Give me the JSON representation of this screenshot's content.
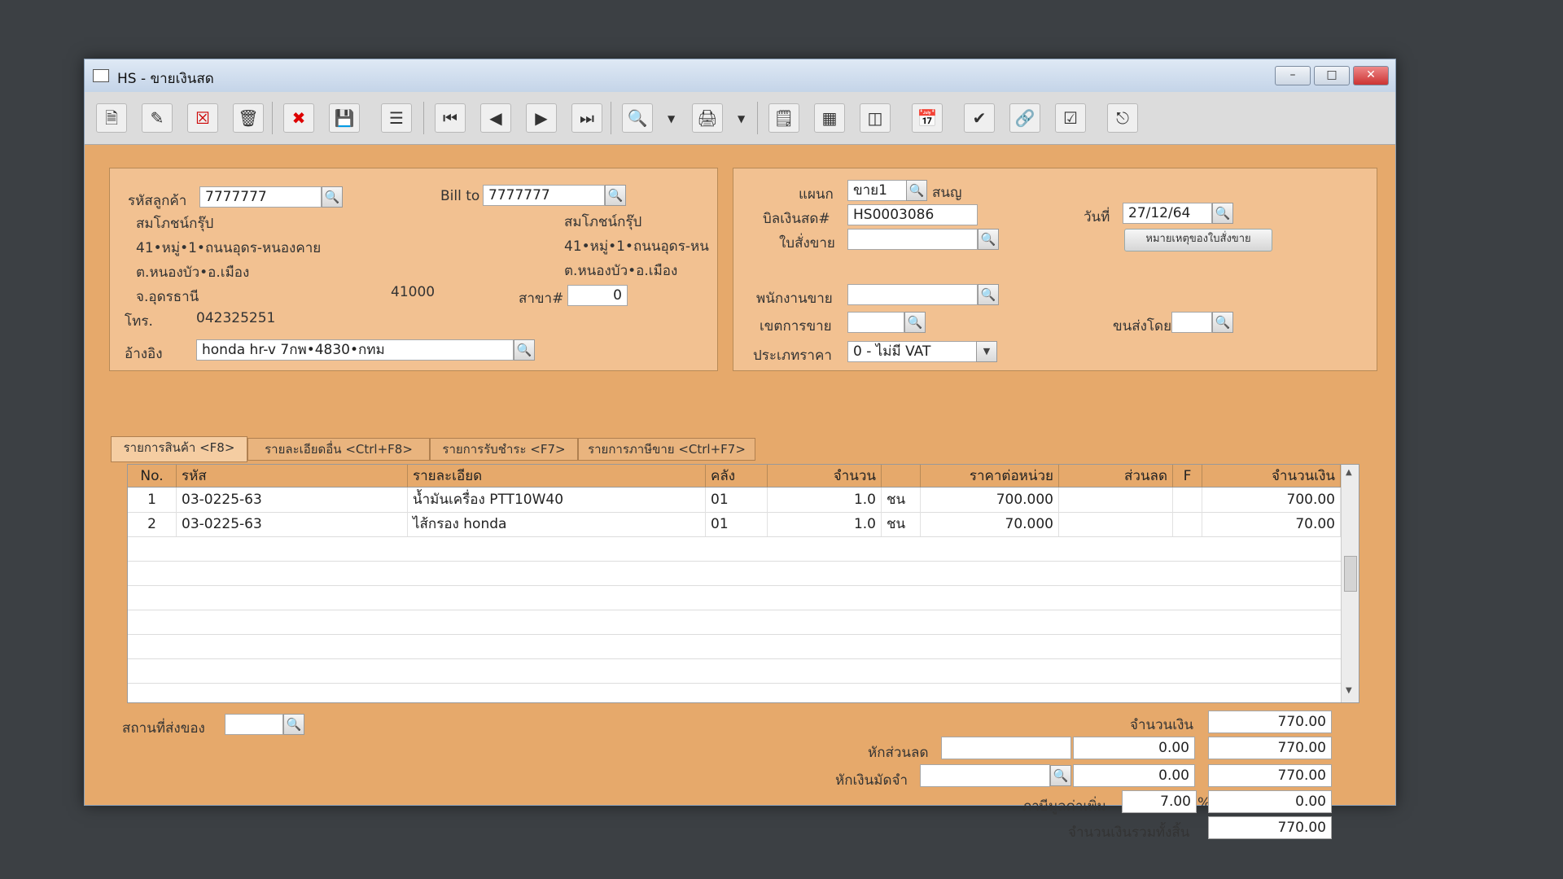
{
  "window": {
    "title": "HS - ขายเงินสด"
  },
  "customer": {
    "code_label": "รหัสลูกค้า",
    "code": "7777777",
    "name": "สมโภชน์กรุ๊ป",
    "address1": "41•หมู่•1•ถนนอุดร-หนองคาย",
    "address2": "ต.หนองบัว•อ.เมือง",
    "province": "จ.อุดรธานี",
    "postcode": "41000",
    "phone_label": "โทร.",
    "phone": "042325251",
    "reference_label": "อ้างอิง",
    "reference": "honda hr-v 7กพ•4830•กทม"
  },
  "billto": {
    "label": "Bill to",
    "code": "7777777",
    "name": "สมโภชน์กรุ๊ป",
    "address1": "41•หมู่•1•ถนนอุดร-หน",
    "address2": "ต.หนองบัว•อ.เมือง",
    "branch_label": "สาขา#",
    "branch": "0"
  },
  "header_right": {
    "department_label": "แผนก",
    "department": "ขาย1",
    "department_name": "สนญ",
    "bill_label": "บิลเงินสด#",
    "bill_no": "HS0003086",
    "date_label": "วันที่",
    "date": "27/12/64",
    "order_label": "ใบสั่งขาย",
    "order_value": "",
    "order_note_button": "หมายเหตุของใบสั่งขาย",
    "salesman_label": "พนักงานขาย",
    "salesman": "",
    "area_label": "เขตการขาย",
    "area": "",
    "shipping_label": "ขนส่งโดย",
    "shipping": "",
    "price_type_label": "ประเภทราคา",
    "price_type": "0 - ไม่มี VAT"
  },
  "tabs": [
    {
      "label": "รายการสินค้า <F8>"
    },
    {
      "label": "รายละเอียดอื่น <Ctrl+F8>"
    },
    {
      "label": "รายการรับชำระ <F7>"
    },
    {
      "label": "รายการภาษีขาย <Ctrl+F7>"
    }
  ],
  "grid": {
    "headers": [
      "No.",
      "รหัส",
      "รายละเอียด",
      "คลัง",
      "จำนวน",
      "ราคาต่อหน่วย",
      "ส่วนลด",
      "F",
      "จำนวนเงิน"
    ],
    "rows": [
      {
        "no": "1",
        "code": "03-0225-63",
        "desc": "น้ำมันเครื่อง PTT10W40",
        "wh": "01",
        "qty": "1.0",
        "unit": "ชน",
        "price": "700.000",
        "disc": "",
        "f": "",
        "amount": "700.00"
      },
      {
        "no": "2",
        "code": "03-0225-63",
        "desc": "ไส้กรอง honda",
        "wh": "01",
        "qty": "1.0",
        "unit": "ชน",
        "price": "70.000",
        "disc": "",
        "f": "",
        "amount": "70.00"
      }
    ]
  },
  "footer": {
    "delivery_label": "สถานที่ส่งของ",
    "delivery": "",
    "amount_label": "จำนวนเงิน",
    "amount": "770.00",
    "discount_label": "หักส่วนลด",
    "discount_text": "",
    "discount_value": "0.00",
    "after_discount": "770.00",
    "deposit_label": "หักเงินมัดจำ",
    "deposit_text": "",
    "deposit_value": "0.00",
    "after_deposit": "770.00",
    "vat_label": "ภาษีมูลค่าเพิ่ม",
    "vat_rate": "7.00",
    "vat_percent": "%",
    "vat_amount": "0.00",
    "grand_total_label": "จำนวนเงินรวมทั้งสิ้น",
    "grand_total": "770.00"
  },
  "colors": {
    "form_bg": "#e6a96b",
    "panel_bg": "#f2c191",
    "header_bg": "#e6a96b"
  }
}
